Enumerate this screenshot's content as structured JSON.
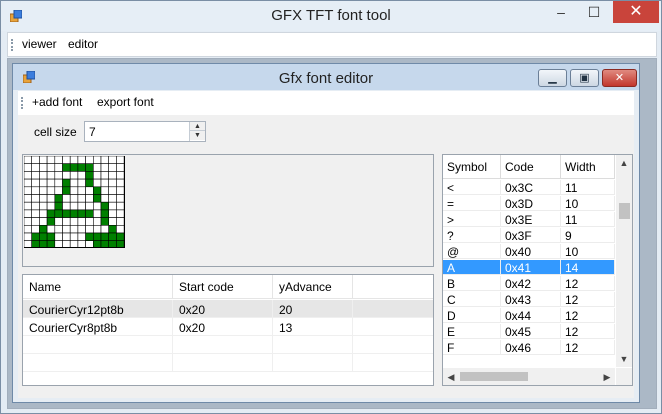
{
  "outer_window": {
    "title": "GFX TFT font tool",
    "controls": {
      "minimize": "–",
      "maximize": "☐",
      "close": "✕"
    },
    "menu": [
      {
        "label": "viewer"
      },
      {
        "label": "editor"
      }
    ]
  },
  "inner_window": {
    "title": "Gfx font editor",
    "controls": {
      "minimize": "▁",
      "maximize": "▣",
      "close": "✕"
    },
    "menu": [
      {
        "label": "+add font"
      },
      {
        "label": "export font"
      }
    ],
    "cell_size": {
      "label": "cell size",
      "value": "7"
    },
    "glyph_bitmap": {
      "rows": [
        "0000000000000",
        "0000011110000",
        "0000000010000",
        "0000010010000",
        "0000010001000",
        "0000100001000",
        "0000100000100",
        "0001111110100",
        "0001000000100",
        "0010000000010",
        "0111000011111",
        "0111000001111"
      ],
      "on_color": "#008000"
    },
    "fonts_table": {
      "columns": [
        "Name",
        "Start code",
        "yAdvance"
      ],
      "rows": [
        {
          "name": "CourierCyr12pt8b",
          "start": "0x20",
          "yadvance": "20",
          "selected": true
        },
        {
          "name": "CourierCyr8pt8b",
          "start": "0x20",
          "yadvance": "13",
          "selected": false
        }
      ]
    },
    "symbols_table": {
      "columns": [
        "Symbol",
        "Code",
        "Width"
      ],
      "rows": [
        {
          "symbol": "<",
          "code": "0x3C",
          "width": "11"
        },
        {
          "symbol": "=",
          "code": "0x3D",
          "width": "10"
        },
        {
          "symbol": ">",
          "code": "0x3E",
          "width": "11"
        },
        {
          "symbol": "?",
          "code": "0x3F",
          "width": "9"
        },
        {
          "symbol": "@",
          "code": "0x40",
          "width": "10"
        },
        {
          "symbol": "A",
          "code": "0x41",
          "width": "14",
          "selected": true
        },
        {
          "symbol": "B",
          "code": "0x42",
          "width": "12"
        },
        {
          "symbol": "C",
          "code": "0x43",
          "width": "12"
        },
        {
          "symbol": "D",
          "code": "0x44",
          "width": "12"
        },
        {
          "symbol": "E",
          "code": "0x45",
          "width": "12"
        },
        {
          "symbol": "F",
          "code": "0x46",
          "width": "12"
        }
      ]
    }
  },
  "colors": {
    "selection": "#3399ff",
    "close_button": "#c9443b"
  }
}
